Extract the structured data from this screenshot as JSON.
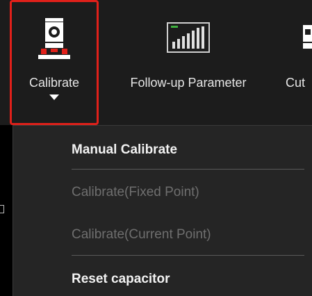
{
  "toolbar": {
    "items": [
      {
        "label": "Calibrate",
        "icon": "calibrate-icon",
        "selected": true,
        "has_dropdown": true
      },
      {
        "label": "Follow-up Parameter",
        "icon": "bar-chart-icon"
      },
      {
        "label": "Cut",
        "icon": "cut-tool-icon"
      }
    ]
  },
  "menu": {
    "items": [
      {
        "label": "Manual Calibrate",
        "enabled": true
      },
      {
        "label": "Calibrate(Fixed Point)",
        "enabled": false
      },
      {
        "label": "Calibrate(Current Point)",
        "enabled": false
      },
      {
        "label": "Reset capacitor",
        "enabled": true
      }
    ]
  },
  "colors": {
    "toolbar_bg": "#1c1c1c",
    "menu_bg": "#252525",
    "highlight_border": "#e0201a",
    "enabled_text": "#f2f2f2",
    "disabled_text": "#6f6f6f"
  }
}
